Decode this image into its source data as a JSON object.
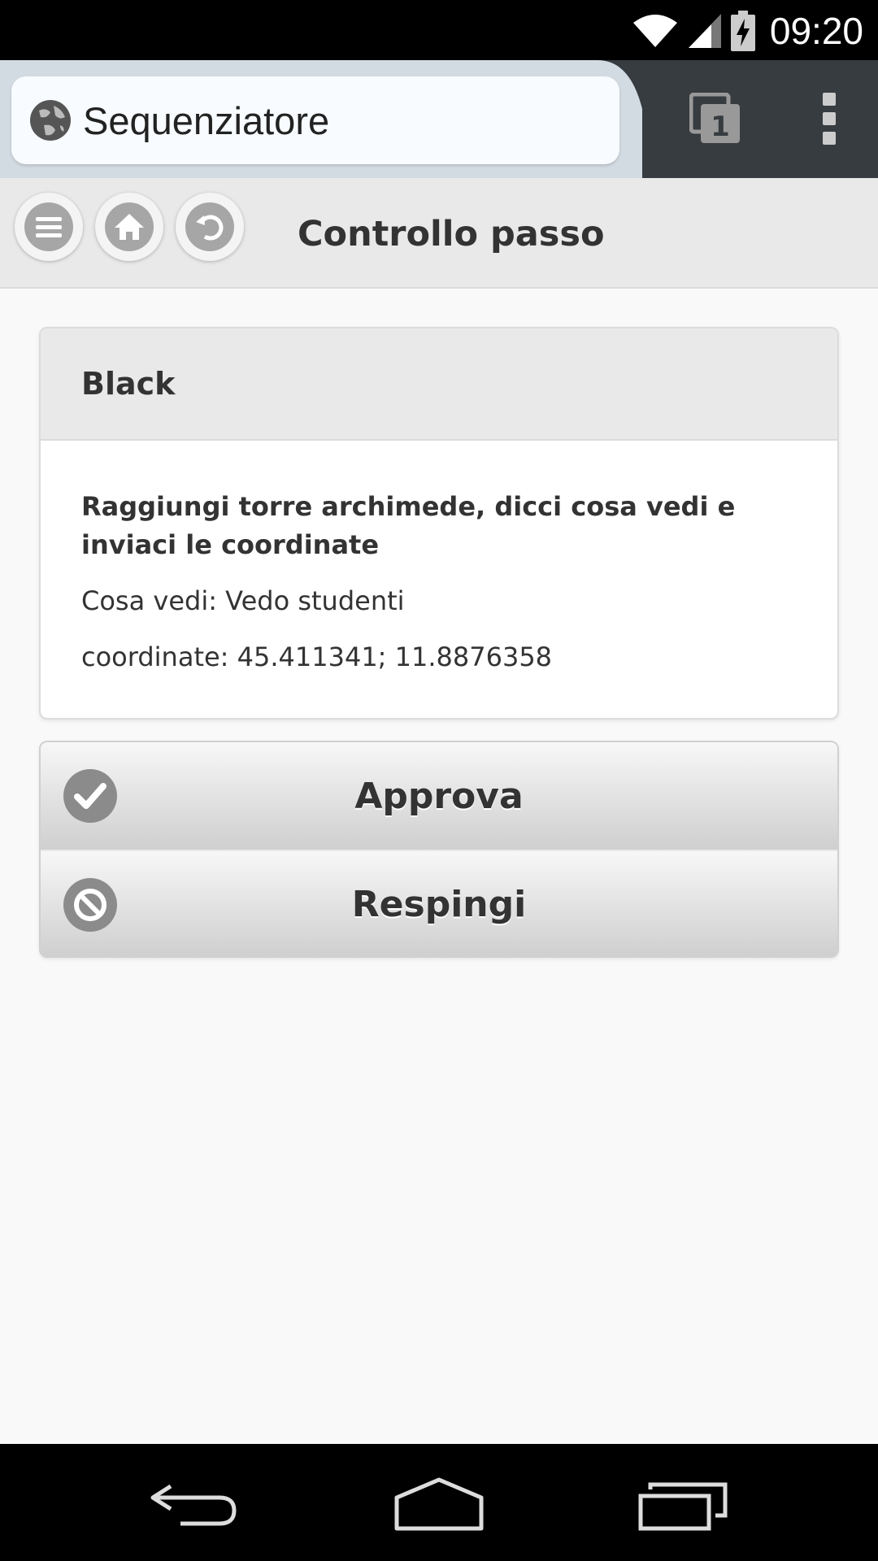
{
  "status_bar": {
    "time": "09:20",
    "icons": [
      "wifi-icon",
      "signal-icon",
      "battery-charging-icon"
    ]
  },
  "browser": {
    "url_title": "Sequenziatore",
    "tab_count": "1",
    "icons": [
      "globe-icon",
      "tabs-icon",
      "overflow-menu-icon"
    ]
  },
  "header": {
    "title": "Controllo passo",
    "buttons": [
      "menu-icon",
      "home-icon",
      "back-arrow-icon"
    ]
  },
  "card": {
    "title": "Black",
    "question": "Raggiungi torre archimede, dicci cosa vedi e inviaci le coordinate",
    "lines": [
      "Cosa vedi: Vedo studenti",
      "coordinate: 45.411341; 11.8876358"
    ]
  },
  "actions": {
    "approve_label": "Approva",
    "reject_label": "Respingi"
  },
  "nav": {
    "icons": [
      "back-nav-icon",
      "home-nav-icon",
      "recents-nav-icon"
    ]
  }
}
